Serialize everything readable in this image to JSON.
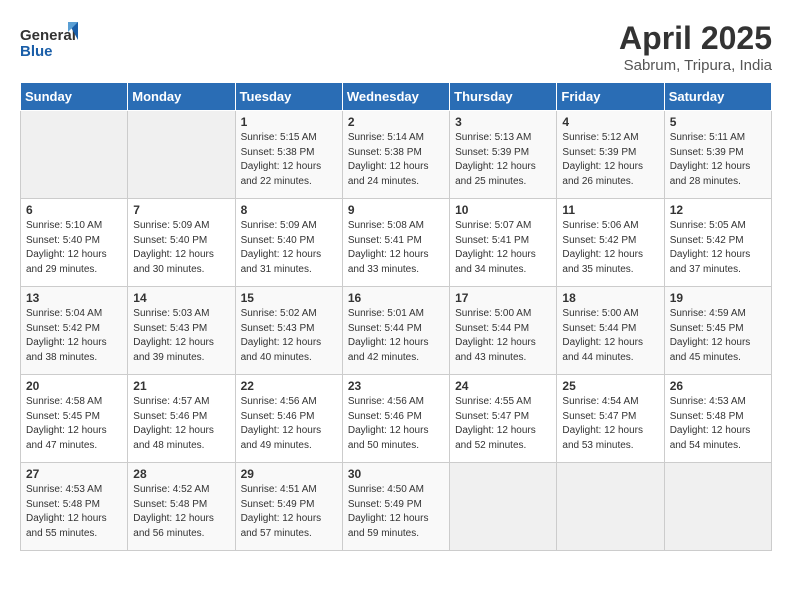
{
  "header": {
    "logo_general": "General",
    "logo_blue": "Blue",
    "title": "April 2025",
    "subtitle": "Sabrum, Tripura, India"
  },
  "days_of_week": [
    "Sunday",
    "Monday",
    "Tuesday",
    "Wednesday",
    "Thursday",
    "Friday",
    "Saturday"
  ],
  "weeks": [
    [
      {
        "day": "",
        "info": ""
      },
      {
        "day": "",
        "info": ""
      },
      {
        "day": "1",
        "info": "Sunrise: 5:15 AM\nSunset: 5:38 PM\nDaylight: 12 hours and 22 minutes."
      },
      {
        "day": "2",
        "info": "Sunrise: 5:14 AM\nSunset: 5:38 PM\nDaylight: 12 hours and 24 minutes."
      },
      {
        "day": "3",
        "info": "Sunrise: 5:13 AM\nSunset: 5:39 PM\nDaylight: 12 hours and 25 minutes."
      },
      {
        "day": "4",
        "info": "Sunrise: 5:12 AM\nSunset: 5:39 PM\nDaylight: 12 hours and 26 minutes."
      },
      {
        "day": "5",
        "info": "Sunrise: 5:11 AM\nSunset: 5:39 PM\nDaylight: 12 hours and 28 minutes."
      }
    ],
    [
      {
        "day": "6",
        "info": "Sunrise: 5:10 AM\nSunset: 5:40 PM\nDaylight: 12 hours and 29 minutes."
      },
      {
        "day": "7",
        "info": "Sunrise: 5:09 AM\nSunset: 5:40 PM\nDaylight: 12 hours and 30 minutes."
      },
      {
        "day": "8",
        "info": "Sunrise: 5:09 AM\nSunset: 5:40 PM\nDaylight: 12 hours and 31 minutes."
      },
      {
        "day": "9",
        "info": "Sunrise: 5:08 AM\nSunset: 5:41 PM\nDaylight: 12 hours and 33 minutes."
      },
      {
        "day": "10",
        "info": "Sunrise: 5:07 AM\nSunset: 5:41 PM\nDaylight: 12 hours and 34 minutes."
      },
      {
        "day": "11",
        "info": "Sunrise: 5:06 AM\nSunset: 5:42 PM\nDaylight: 12 hours and 35 minutes."
      },
      {
        "day": "12",
        "info": "Sunrise: 5:05 AM\nSunset: 5:42 PM\nDaylight: 12 hours and 37 minutes."
      }
    ],
    [
      {
        "day": "13",
        "info": "Sunrise: 5:04 AM\nSunset: 5:42 PM\nDaylight: 12 hours and 38 minutes."
      },
      {
        "day": "14",
        "info": "Sunrise: 5:03 AM\nSunset: 5:43 PM\nDaylight: 12 hours and 39 minutes."
      },
      {
        "day": "15",
        "info": "Sunrise: 5:02 AM\nSunset: 5:43 PM\nDaylight: 12 hours and 40 minutes."
      },
      {
        "day": "16",
        "info": "Sunrise: 5:01 AM\nSunset: 5:44 PM\nDaylight: 12 hours and 42 minutes."
      },
      {
        "day": "17",
        "info": "Sunrise: 5:00 AM\nSunset: 5:44 PM\nDaylight: 12 hours and 43 minutes."
      },
      {
        "day": "18",
        "info": "Sunrise: 5:00 AM\nSunset: 5:44 PM\nDaylight: 12 hours and 44 minutes."
      },
      {
        "day": "19",
        "info": "Sunrise: 4:59 AM\nSunset: 5:45 PM\nDaylight: 12 hours and 45 minutes."
      }
    ],
    [
      {
        "day": "20",
        "info": "Sunrise: 4:58 AM\nSunset: 5:45 PM\nDaylight: 12 hours and 47 minutes."
      },
      {
        "day": "21",
        "info": "Sunrise: 4:57 AM\nSunset: 5:46 PM\nDaylight: 12 hours and 48 minutes."
      },
      {
        "day": "22",
        "info": "Sunrise: 4:56 AM\nSunset: 5:46 PM\nDaylight: 12 hours and 49 minutes."
      },
      {
        "day": "23",
        "info": "Sunrise: 4:56 AM\nSunset: 5:46 PM\nDaylight: 12 hours and 50 minutes."
      },
      {
        "day": "24",
        "info": "Sunrise: 4:55 AM\nSunset: 5:47 PM\nDaylight: 12 hours and 52 minutes."
      },
      {
        "day": "25",
        "info": "Sunrise: 4:54 AM\nSunset: 5:47 PM\nDaylight: 12 hours and 53 minutes."
      },
      {
        "day": "26",
        "info": "Sunrise: 4:53 AM\nSunset: 5:48 PM\nDaylight: 12 hours and 54 minutes."
      }
    ],
    [
      {
        "day": "27",
        "info": "Sunrise: 4:53 AM\nSunset: 5:48 PM\nDaylight: 12 hours and 55 minutes."
      },
      {
        "day": "28",
        "info": "Sunrise: 4:52 AM\nSunset: 5:48 PM\nDaylight: 12 hours and 56 minutes."
      },
      {
        "day": "29",
        "info": "Sunrise: 4:51 AM\nSunset: 5:49 PM\nDaylight: 12 hours and 57 minutes."
      },
      {
        "day": "30",
        "info": "Sunrise: 4:50 AM\nSunset: 5:49 PM\nDaylight: 12 hours and 59 minutes."
      },
      {
        "day": "",
        "info": ""
      },
      {
        "day": "",
        "info": ""
      },
      {
        "day": "",
        "info": ""
      }
    ]
  ]
}
